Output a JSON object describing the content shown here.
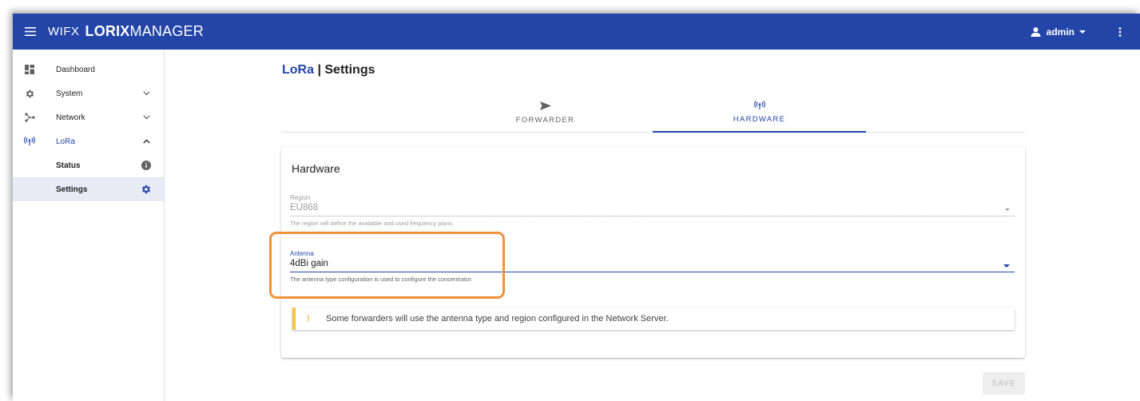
{
  "header": {
    "brand_prefix": "WIFX",
    "brand_bold": "LORIX",
    "brand_rest": "MANAGER",
    "user": "admin"
  },
  "sidebar": {
    "items": [
      {
        "label": "Dashboard",
        "icon": "dashboard-icon"
      },
      {
        "label": "System",
        "icon": "gear-icon"
      },
      {
        "label": "Network",
        "icon": "network-icon"
      },
      {
        "label": "LoRa",
        "icon": "antenna-icon"
      },
      {
        "label": "Status",
        "icon": "info-icon"
      },
      {
        "label": "Settings",
        "icon": "gear-icon"
      }
    ]
  },
  "page": {
    "title_accent": "LoRa",
    "title_sep": " | ",
    "title_rest": "Settings"
  },
  "tabs": [
    {
      "label": "FORWARDER",
      "icon": "send-icon"
    },
    {
      "label": "HARDWARE",
      "icon": "antenna-icon",
      "active": true
    }
  ],
  "card": {
    "title": "Hardware",
    "region": {
      "label": "Region",
      "value": "EU868",
      "hint": "The region will define the available and used frequency plans."
    },
    "antenna": {
      "label": "Antenna",
      "value": "4dBi gain",
      "hint": "The antenna type configuration is used to configure the concentrator."
    },
    "alert": {
      "icon": "!",
      "text": "Some forwarders will use the antenna type and region configured in the Network Server."
    }
  },
  "actions": {
    "save_label": "SAVE"
  },
  "colors": {
    "primary": "#2445a8",
    "warning": "#f6c343",
    "highlight": "#f0923a"
  }
}
